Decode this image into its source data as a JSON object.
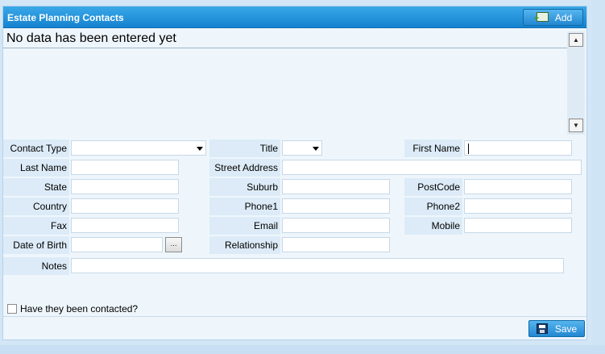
{
  "header": {
    "title": "Estate Planning Contacts",
    "add_label": "Add"
  },
  "list": {
    "empty_message": "No data has been entered yet"
  },
  "form": {
    "contact_type": {
      "label": "Contact Type",
      "value": ""
    },
    "title": {
      "label": "Title",
      "value": ""
    },
    "first_name": {
      "label": "First Name",
      "value": ""
    },
    "last_name": {
      "label": "Last Name",
      "value": ""
    },
    "street_address": {
      "label": "Street Address",
      "value": ""
    },
    "state": {
      "label": "State",
      "value": ""
    },
    "suburb": {
      "label": "Suburb",
      "value": ""
    },
    "postcode": {
      "label": "PostCode",
      "value": ""
    },
    "country": {
      "label": "Country",
      "value": ""
    },
    "phone1": {
      "label": "Phone1",
      "value": ""
    },
    "phone2": {
      "label": "Phone2",
      "value": ""
    },
    "fax": {
      "label": "Fax",
      "value": ""
    },
    "email": {
      "label": "Email",
      "value": ""
    },
    "mobile": {
      "label": "Mobile",
      "value": ""
    },
    "date_of_birth": {
      "label": "Date of Birth",
      "value": "",
      "picker_label": "..."
    },
    "relationship": {
      "label": "Relationship",
      "value": ""
    },
    "notes": {
      "label": "Notes",
      "value": ""
    },
    "contacted": {
      "label": "Have they been contacted?",
      "checked": false
    }
  },
  "footer": {
    "save_label": "Save"
  },
  "colors": {
    "header": "#1582cf",
    "panel": "#eef6fc",
    "label_bg": "#dcebf7"
  },
  "icons": {
    "add": "add-card-icon",
    "save": "floppy-disk-icon",
    "scroll_up": "up-arrow-icon",
    "scroll_down": "down-arrow-icon"
  }
}
